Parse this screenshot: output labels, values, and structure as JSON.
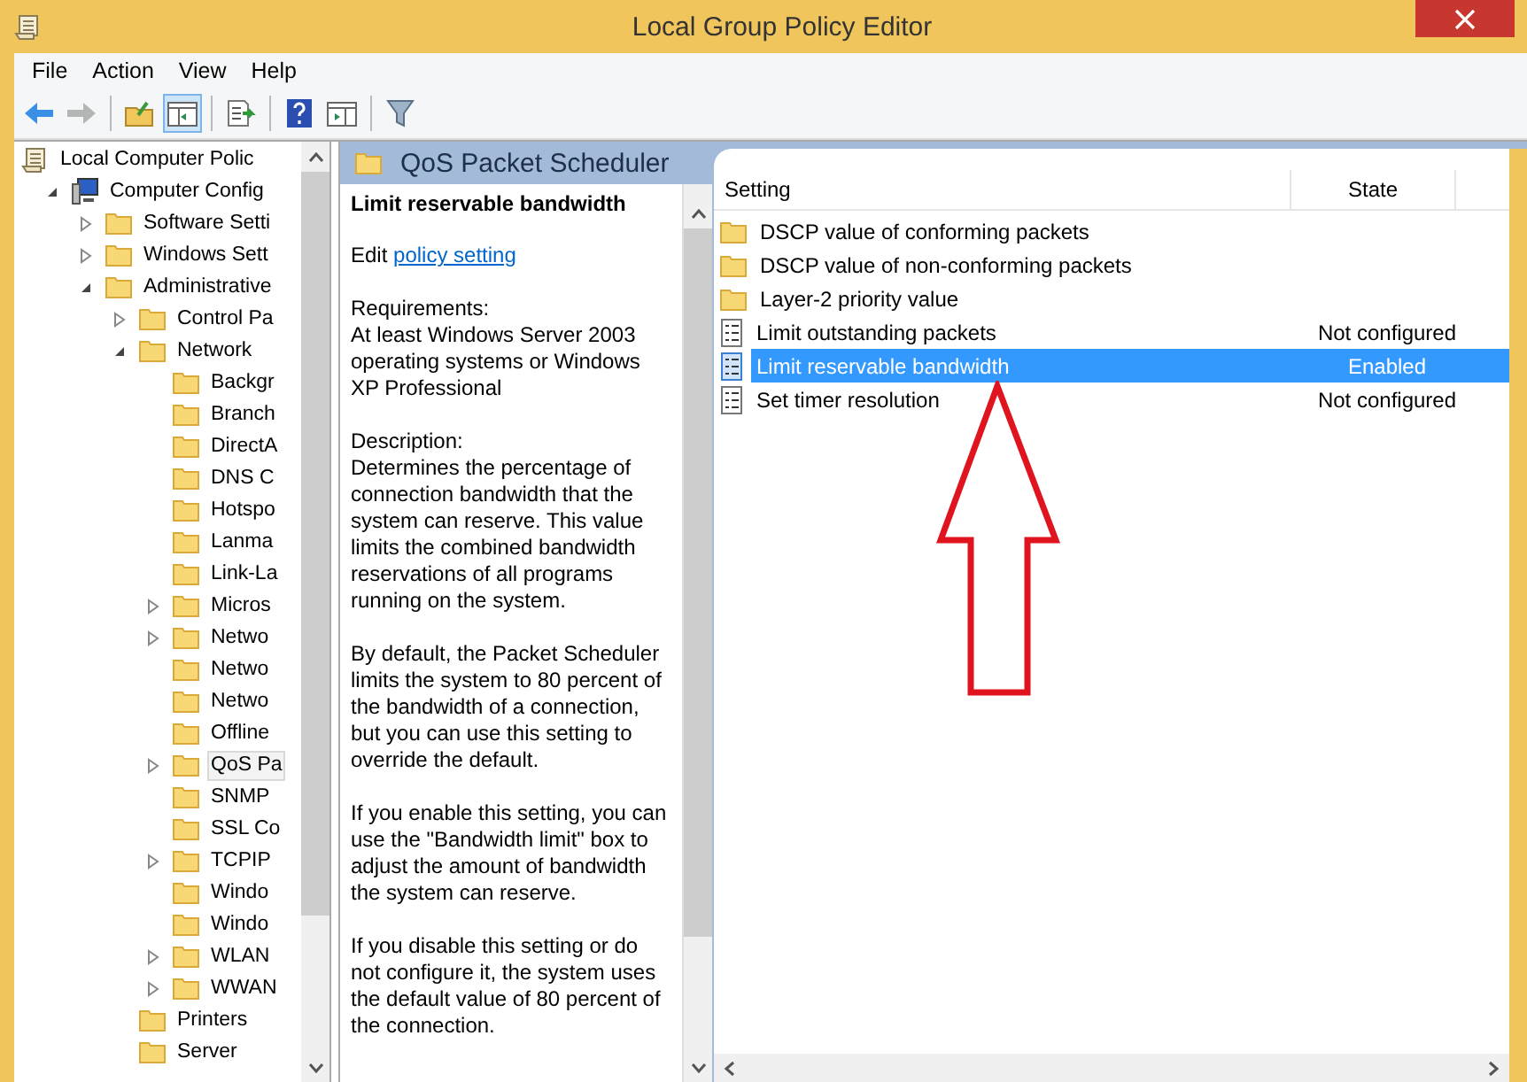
{
  "window": {
    "title": "Local Group Policy Editor"
  },
  "menu": [
    "File",
    "Action",
    "View",
    "Help"
  ],
  "toolbar": [
    {
      "kind": "back",
      "disabled": false,
      "pressed": false
    },
    {
      "kind": "forward",
      "disabled": true,
      "pressed": false
    },
    {
      "kind": "separator"
    },
    {
      "kind": "up",
      "disabled": false,
      "pressed": false
    },
    {
      "kind": "tree",
      "disabled": false,
      "pressed": true
    },
    {
      "kind": "separator"
    },
    {
      "kind": "export",
      "disabled": false,
      "pressed": false
    },
    {
      "kind": "separator"
    },
    {
      "kind": "help",
      "disabled": false,
      "pressed": false
    },
    {
      "kind": "actionpane",
      "disabled": false,
      "pressed": false
    },
    {
      "kind": "separator"
    },
    {
      "kind": "filter",
      "disabled": false,
      "pressed": false
    }
  ],
  "tree": [
    {
      "label": "Local Computer Polic",
      "kind": "policy",
      "selected": false,
      "children": [
        {
          "label": "Computer Config",
          "kind": "computer",
          "expanded": true,
          "selected": false,
          "children": [
            {
              "label": "Software Setti",
              "kind": "folder",
              "expanded": false,
              "selected": false
            },
            {
              "label": "Windows Sett",
              "kind": "folder",
              "expanded": false,
              "selected": false
            },
            {
              "label": "Administrative",
              "kind": "folder",
              "expanded": true,
              "selected": false,
              "children": [
                {
                  "label": "Control Pa",
                  "kind": "folder",
                  "expanded": false,
                  "selected": false
                },
                {
                  "label": "Network",
                  "kind": "folder",
                  "expanded": true,
                  "selected": false,
                  "children": [
                    {
                      "label": "Backgr",
                      "kind": "folder",
                      "selected": false
                    },
                    {
                      "label": "Branch",
                      "kind": "folder",
                      "selected": false
                    },
                    {
                      "label": "DirectA",
                      "kind": "folder",
                      "selected": false
                    },
                    {
                      "label": "DNS C",
                      "kind": "folder",
                      "selected": false
                    },
                    {
                      "label": "Hotspo",
                      "kind": "folder",
                      "selected": false
                    },
                    {
                      "label": "Lanma",
                      "kind": "folder",
                      "selected": false
                    },
                    {
                      "label": "Link-La",
                      "kind": "folder",
                      "selected": false
                    },
                    {
                      "label": "Micros",
                      "kind": "folder",
                      "expanded": false,
                      "selected": false
                    },
                    {
                      "label": "Netwo",
                      "kind": "folder",
                      "expanded": false,
                      "selected": false
                    },
                    {
                      "label": "Netwo",
                      "kind": "folder",
                      "selected": false
                    },
                    {
                      "label": "Netwo",
                      "kind": "folder",
                      "selected": false
                    },
                    {
                      "label": "Offline",
                      "kind": "folder",
                      "selected": false
                    },
                    {
                      "label": "QoS Pa",
                      "kind": "folder",
                      "expanded": false,
                      "selected": true
                    },
                    {
                      "label": "SNMP",
                      "kind": "folder",
                      "selected": false
                    },
                    {
                      "label": "SSL Co",
                      "kind": "folder",
                      "selected": false
                    },
                    {
                      "label": "TCPIP",
                      "kind": "folder",
                      "expanded": false,
                      "selected": false
                    },
                    {
                      "label": "Windo",
                      "kind": "folder",
                      "selected": false
                    },
                    {
                      "label": "Windo",
                      "kind": "folder",
                      "selected": false
                    },
                    {
                      "label": "WLAN",
                      "kind": "folder",
                      "expanded": false,
                      "selected": false
                    },
                    {
                      "label": "WWAN",
                      "kind": "folder",
                      "expanded": false,
                      "selected": false
                    }
                  ]
                },
                {
                  "label": "Printers",
                  "kind": "folder",
                  "selected": false
                },
                {
                  "label": "Server",
                  "kind": "folder",
                  "selected": false
                }
              ]
            }
          ]
        }
      ]
    }
  ],
  "header": {
    "title": "QoS Packet Scheduler"
  },
  "description": {
    "title": "Limit reservable bandwidth",
    "edit_prefix": "Edit",
    "link": "policy setting",
    "paragraphs": [
      "Requirements:\nAt least Windows Server 2003 operating systems or Windows XP Professional",
      "Description:\nDetermines the percentage of connection bandwidth that the system can reserve. This value limits the combined bandwidth reservations of all programs running on the system.",
      "By default, the Packet Scheduler limits the system to 80 percent of the bandwidth of a connection, but you can use this setting to override the default.",
      "If you enable this setting, you can use the \"Bandwidth limit\" box to adjust the amount of bandwidth the system can reserve.",
      "If you disable this setting or do not configure it, the system uses the default value of 80 percent of the connection."
    ]
  },
  "table": {
    "columns": [
      "Setting",
      "State"
    ],
    "rows": [
      {
        "kind": "folder",
        "setting": "DSCP value of conforming packets",
        "selected": false
      },
      {
        "kind": "folder",
        "setting": "DSCP value of non-conforming packets",
        "selected": false
      },
      {
        "kind": "folder",
        "setting": "Layer-2 priority value",
        "selected": false
      },
      {
        "kind": "policy",
        "setting": "Limit outstanding packets",
        "state": "Not configured",
        "selected": false
      },
      {
        "kind": "policy",
        "setting": "Limit reservable bandwidth",
        "state": "Enabled",
        "selected": true
      },
      {
        "kind": "policy",
        "setting": "Set timer resolution",
        "state": "Not configured",
        "selected": false
      }
    ]
  }
}
